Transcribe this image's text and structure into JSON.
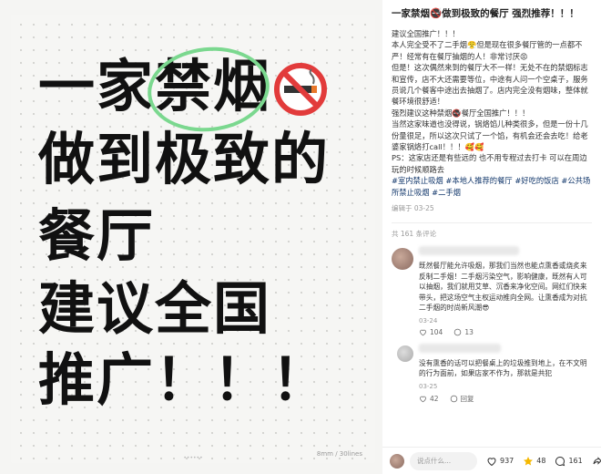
{
  "poster": {
    "line1": "一家禁烟",
    "line2": "做到极致的",
    "line3": "餐厅",
    "line4": "建议全国",
    "line5": "推广！！！",
    "watermark": "8mm / 30lines",
    "icon": "no-smoking-icon",
    "highlight_color": "#7bd88f"
  },
  "post": {
    "title": "一家禁烟🚭做到极致的餐厅 强烈推荐！！！",
    "paragraphs": [
      "建议全国推广！！！",
      "本人完全受不了二手烟😤但是现在很多餐厅管的一点都不严！经常有在餐厅抽烟的人！非常讨厌😡",
      "但是！这次偶然来到的餐厅大不一样！无处不在的禁烟标志和宣传，店不大还需要等位，中途有人问一个空桌子，服务员说几个餐客中途出去抽烟了。店内完全没有烟味，整体就餐环境很舒适！",
      "强烈建议这种禁烟🚭餐厅全国推广！！！",
      "当然这家味道也没得说，锅烙馅儿种类很多，但是一份十几份量很足，所以这次只试了一个馅，有机会还会去吃！给老婆家锅烙打call！！！🥰🥰",
      "PS：这家店还是有些远的 也不用专程过去打卡 可以在周边玩的时候顺路去"
    ],
    "tags": "#室内禁止吸烟 #本地人推荐的餐厅 #好吃的饭店 #公共场所禁止吸烟 #二手烟",
    "edited": "编辑于 03-25",
    "comment_count": "共 161 条评论"
  },
  "comments": [
    {
      "text": "既然餐厅能允许吸烟，那我们当然也能点熏香或烧炙来反制二手烟！二手烟污染空气，影响健康，既然有人可以抽烟，我们就用艾草、沉香来净化空间。网红们快来带头，把这场空气主权运动推向全网。让熏香成为对抗二手烟的时尚新风潮😎",
      "date": "03-24",
      "likes": "104",
      "replies": "13"
    },
    {
      "text": "没有熏香的话可以把餐桌上的垃圾推到地上，在不文明的行为面前，如果店家不作为，那就是共犯",
      "date": "03-25",
      "likes": "42",
      "reply_label": "回复"
    }
  ],
  "bottom_bar": {
    "placeholder": "说点什么...",
    "likes": "937",
    "stars": "48",
    "comments": "161"
  }
}
